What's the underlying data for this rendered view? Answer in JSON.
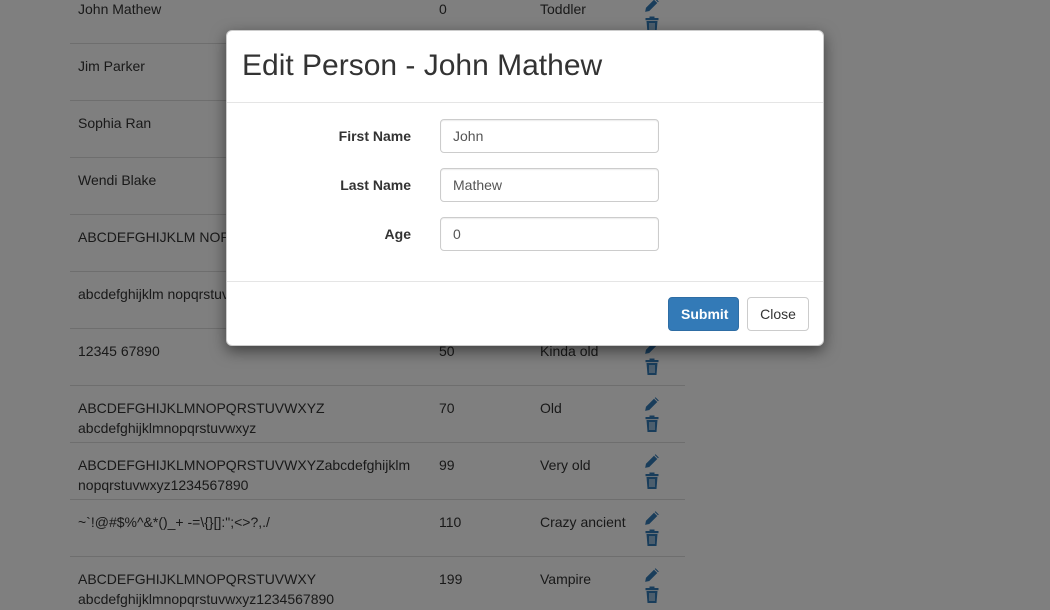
{
  "table": {
    "rows": [
      {
        "name": "John Mathew",
        "age": "0",
        "description": "Toddler"
      },
      {
        "name": "Jim Parker",
        "age": "",
        "description": ""
      },
      {
        "name": "Sophia Ran",
        "age": "",
        "description": ""
      },
      {
        "name": "Wendi Blake",
        "age": "",
        "description": ""
      },
      {
        "name": "ABCDEFGHIJKLM NOPQRSTUVWXYZ",
        "age": "",
        "description": ""
      },
      {
        "name": "abcdefghijklm nopqrstuvwxyz",
        "age": "",
        "description": ""
      },
      {
        "name": "12345 67890",
        "age": "50",
        "description": "Kinda old"
      },
      {
        "name": "ABCDEFGHIJKLMNOPQRSTUVWXYZ abcdefghijklmnopqrstuvwxyz",
        "age": "70",
        "description": "Old"
      },
      {
        "name": "ABCDEFGHIJKLMNOPQRSTUVWXYZabcdefghijklm nopqrstuvwxyz1234567890",
        "age": "99",
        "description": "Very old"
      },
      {
        "name": "~`!@#$%^&*()_+ -=\\{}[]:\";<>?,./",
        "age": "110",
        "description": "Crazy ancient"
      },
      {
        "name": "ABCDEFGHIJKLMNOPQRSTUVWXY abcdefghijklmnopqrstuvwxyz1234567890",
        "age": "199",
        "description": "Vampire"
      }
    ],
    "icons": {
      "edit": "pencil-icon",
      "delete": "trash-icon"
    },
    "icon_color": "#337ab7"
  },
  "modal": {
    "title": "Edit Person - John Mathew",
    "fields": {
      "first_name": {
        "label": "First Name",
        "value": "John"
      },
      "last_name": {
        "label": "Last Name",
        "value": "Mathew"
      },
      "age": {
        "label": "Age",
        "value": "0"
      }
    },
    "submit_label": "Submit",
    "close_label": "Close",
    "primary_color": "#337ab7"
  }
}
